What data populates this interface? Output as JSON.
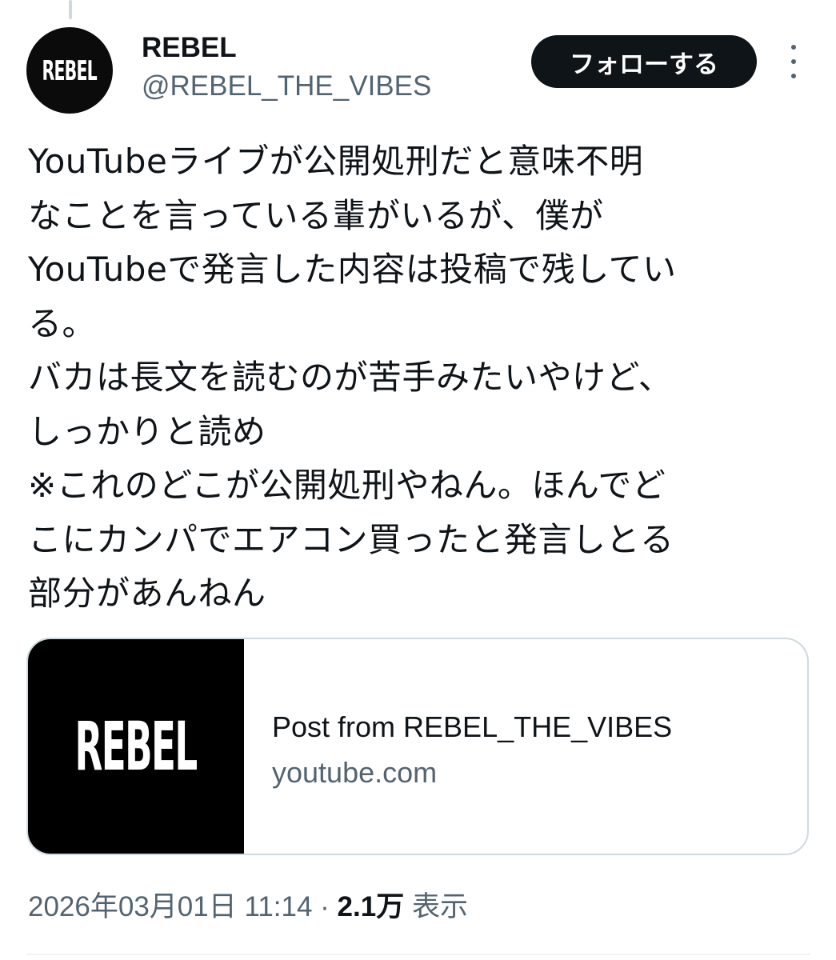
{
  "tweet": {
    "author": {
      "display_name": "REBEL",
      "handle": "@REBEL_THE_VIBES",
      "avatar_text": "REBEL"
    },
    "follow_label": "フォローする",
    "text_lines": [
      "YouTubeライブが公開処刑だと意味不明",
      "なことを言っている輩がいるが、僕が",
      "YouTubeで発言した内容は投稿で残してい",
      "る。",
      "バカは長文を読むのが苦手みたいやけど、",
      "しっかりと読め",
      "※これのどこが公開処刑やねん。ほんでど",
      "こにカンパでエアコン買ったと発言しとる",
      "部分があんねん"
    ],
    "card": {
      "thumbnail_text": "REBEL",
      "title": "Post from REBEL_THE_VIBES",
      "domain": "youtube.com"
    },
    "timestamp": "2026年03月01日 11:14",
    "separator": " · ",
    "views_count": "2.1万",
    "views_label": "表示"
  },
  "icons": {
    "more": "more-dots-vertical-icon"
  },
  "colors": {
    "text_primary": "#0f1419",
    "text_secondary": "#536471",
    "border": "#cfd9de",
    "follow_bg": "#0f1419"
  }
}
